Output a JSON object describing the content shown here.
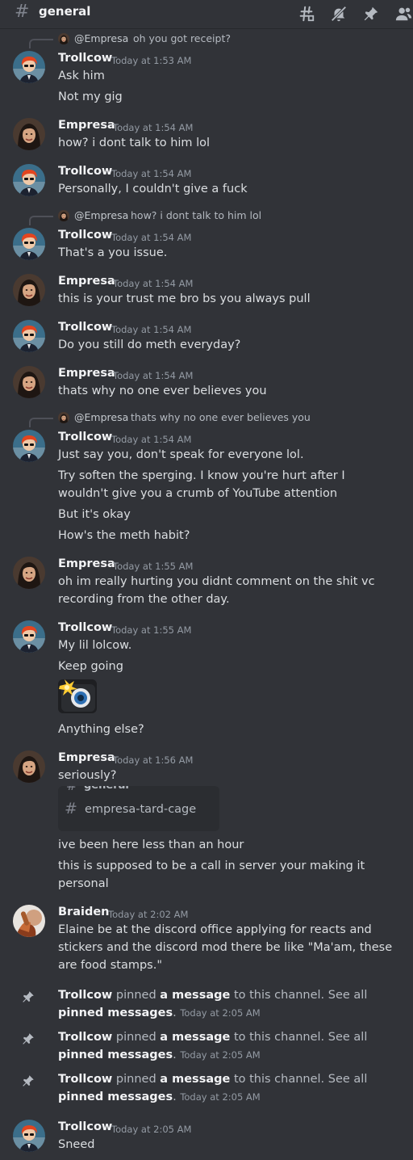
{
  "channel": {
    "name": "general"
  },
  "header_icons": [
    "threads-icon",
    "mute-bell-icon",
    "pin-icon",
    "members-icon"
  ],
  "users": {
    "trollcow": "Trollcow",
    "empresa": "Empresa",
    "braiden": "Braiden"
  },
  "messages": [
    {
      "reply": {
        "name": "@Empresa",
        "text": "oh you got receipt?"
      },
      "author": "Trollcow",
      "time": "Today at 1:53 AM",
      "lines": [
        "Ask him",
        "Not my gig"
      ]
    },
    {
      "author": "Empresa",
      "time": "Today at 1:54 AM",
      "lines": [
        "how? i dont talk to him lol"
      ]
    },
    {
      "author": "Trollcow",
      "time": "Today at 1:54 AM",
      "lines": [
        "Personally, I couldn't give a fuck"
      ]
    },
    {
      "reply": {
        "name": "@Empresa",
        "text": "how? i dont talk to him lol"
      },
      "author": "Trollcow",
      "time": "Today at 1:54 AM",
      "lines": [
        "That's a you issue."
      ]
    },
    {
      "author": "Empresa",
      "time": "Today at 1:54 AM",
      "lines": [
        "this is your trust me bro bs you always pull"
      ]
    },
    {
      "author": "Trollcow",
      "time": "Today at 1:54 AM",
      "lines": [
        "Do you still do meth everyday?"
      ]
    },
    {
      "author": "Empresa",
      "time": "Today at 1:54 AM",
      "lines": [
        "thats why no one ever believes you"
      ]
    },
    {
      "reply": {
        "name": "@Empresa",
        "text": "thats why no one ever believes you"
      },
      "author": "Trollcow",
      "time": "Today at 1:54 AM",
      "lines": [
        "Just say you, don't speak for everyone lol.",
        "Try soften the sperging. I know you're hurt after I",
        "wouldn't give you a crumb of YouTube attention",
        "But it's okay",
        "How's the meth habit?"
      ]
    },
    {
      "author": "Empresa",
      "time": "Today at 1:55 AM",
      "lines": [
        "oh im really hurting you didnt comment on the shit vc",
        "recording from the other day."
      ]
    },
    {
      "author": "Trollcow",
      "time": "Today at 1:55 AM",
      "lines": [
        "My lil lolcow.",
        "Keep going",
        "Anything else?"
      ],
      "sticker": "camera-flash-emoji"
    },
    {
      "author": "Empresa",
      "time": "Today at 1:56 AM",
      "lines": [
        "seriously?",
        "ive been here less than an hour",
        "this is supposed to be a call in server your making it",
        "personal"
      ],
      "channel_embed": {
        "peek": "general",
        "name": "empresa-tard-cage"
      }
    },
    {
      "author": "Braiden",
      "time": "Today at 2:02 AM",
      "lines": [
        "Elaine be at the discord office applying for reacts and",
        "stickers and the discord mod there be like \"Ma'am, these",
        "are food stamps.\""
      ]
    },
    {
      "author": "Trollcow",
      "time": "Today at 2:05 AM",
      "lines": [
        "Sneed"
      ]
    }
  ],
  "pins": [
    {
      "user": "Trollcow",
      "p1": "pinned",
      "p2": "a message",
      "p3": "to this channel. See all",
      "p4": "pinned messages",
      "p5": ".",
      "time": "Today at 2:05 AM"
    },
    {
      "user": "Trollcow",
      "p1": "pinned",
      "p2": "a message",
      "p3": "to this channel. See all",
      "p4": "pinned messages",
      "p5": ".",
      "time": "Today at 2:05 AM"
    },
    {
      "user": "Trollcow",
      "p1": "pinned",
      "p2": "a message",
      "p3": "to this channel. See all",
      "p4": "pinned messages",
      "p5": ".",
      "time": "Today at 2:05 AM"
    }
  ]
}
